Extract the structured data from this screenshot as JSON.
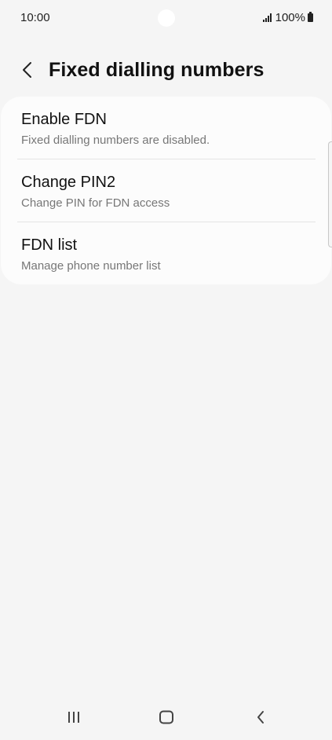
{
  "status_bar": {
    "time": "10:00",
    "battery": "100%"
  },
  "header": {
    "title": "Fixed dialling numbers"
  },
  "settings": {
    "items": [
      {
        "title": "Enable FDN",
        "subtitle": "Fixed dialling numbers are disabled."
      },
      {
        "title": "Change PIN2",
        "subtitle": "Change PIN for FDN access"
      },
      {
        "title": "FDN list",
        "subtitle": "Manage phone number list"
      }
    ]
  },
  "icons": {
    "back": "chevron-left-icon",
    "signal": "signal-icon",
    "battery": "battery-icon",
    "recents": "recents-icon",
    "home": "home-icon",
    "nav_back": "nav-back-icon"
  },
  "colors": {
    "background": "#f5f5f5",
    "card": "#fcfcfc",
    "subtitle": "#777777"
  }
}
